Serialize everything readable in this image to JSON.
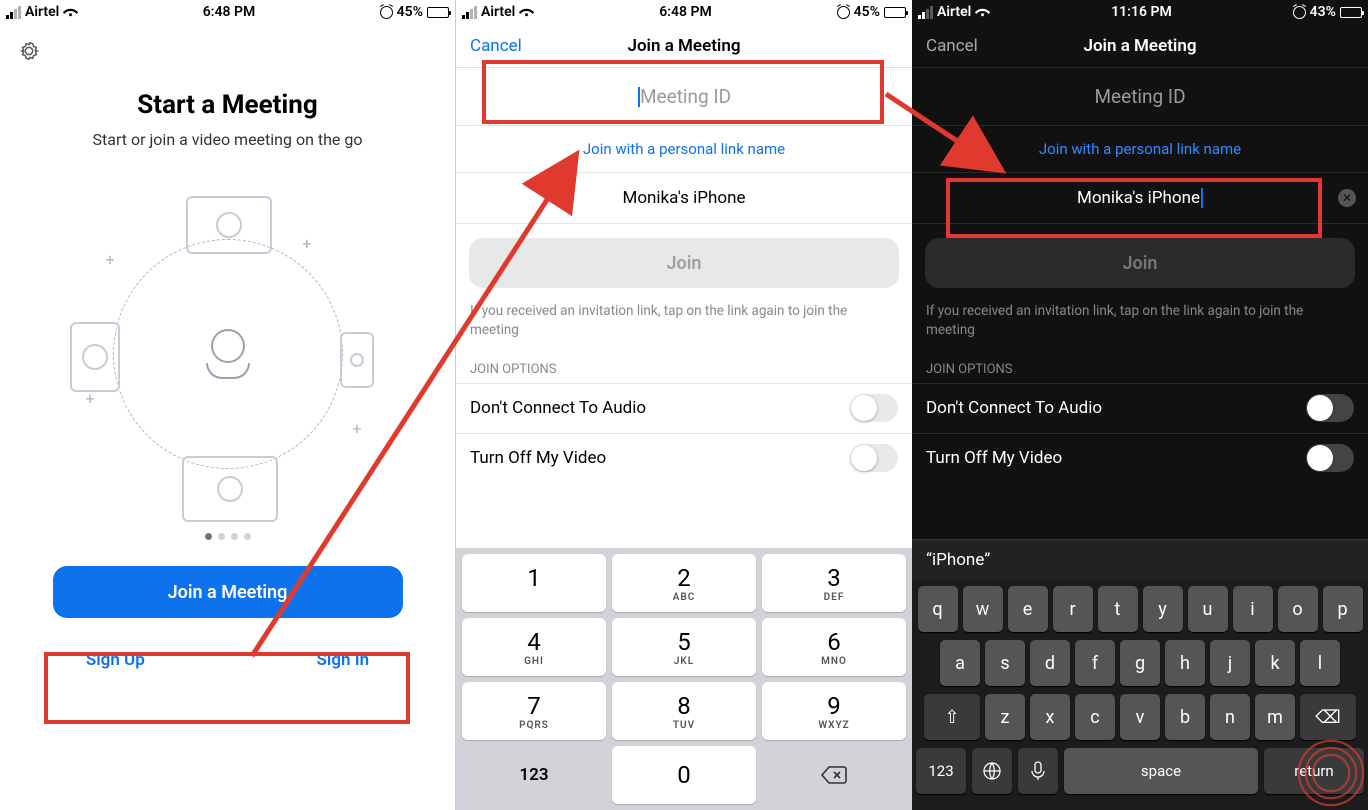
{
  "status": {
    "carrier": "Airtel",
    "time1": "6:48 PM",
    "time2": "6:48 PM",
    "time3": "11:16 PM",
    "battery1": "45%",
    "battery2": "45%",
    "battery3": "43%"
  },
  "screen1": {
    "title": "Start a Meeting",
    "subtitle": "Start or join a video meeting on the go",
    "join_btn": "Join a Meeting",
    "sign_up": "Sign Up",
    "sign_in": "Sign In"
  },
  "screen2": {
    "cancel": "Cancel",
    "title": "Join a Meeting",
    "meeting_id_placeholder": "Meeting ID",
    "personal_link": "Join with a personal link name",
    "device_name": "Monika's iPhone",
    "join_btn": "Join",
    "hint": "If you received an invitation link, tap on the link again to join the meeting",
    "join_options": "JOIN OPTIONS",
    "opt_audio": "Don't Connect To Audio",
    "opt_video": "Turn Off My Video",
    "numpad": {
      "k1": "1",
      "k2": "2",
      "k3": "3",
      "k4": "4",
      "k5": "5",
      "k6": "6",
      "k7": "7",
      "k8": "8",
      "k9": "9",
      "k0": "0",
      "s2": "ABC",
      "s3": "DEF",
      "s4": "GHI",
      "s5": "JKL",
      "s6": "MNO",
      "s7": "PQRS",
      "s8": "TUV",
      "s9": "WXYZ",
      "util": "123"
    }
  },
  "screen3": {
    "cancel": "Cancel",
    "title": "Join a Meeting",
    "meeting_id_placeholder": "Meeting ID",
    "personal_link": "Join with a personal link name",
    "device_name": "Monika's iPhone",
    "join_btn": "Join",
    "hint": "If you received an invitation link, tap on the link again to join the meeting",
    "join_options": "JOIN OPTIONS",
    "opt_audio": "Don't Connect To Audio",
    "opt_video": "Turn Off My Video",
    "kb_suggestion": "“iPhone”",
    "row1": [
      "q",
      "w",
      "e",
      "r",
      "t",
      "y",
      "u",
      "i",
      "o",
      "p"
    ],
    "row2": [
      "a",
      "s",
      "d",
      "f",
      "g",
      "h",
      "j",
      "k",
      "l"
    ],
    "row3": [
      "z",
      "x",
      "c",
      "v",
      "b",
      "n",
      "m"
    ],
    "shift": "⇧",
    "backspace": "⌫",
    "numswitch": "123",
    "space": "space",
    "return": "return"
  }
}
